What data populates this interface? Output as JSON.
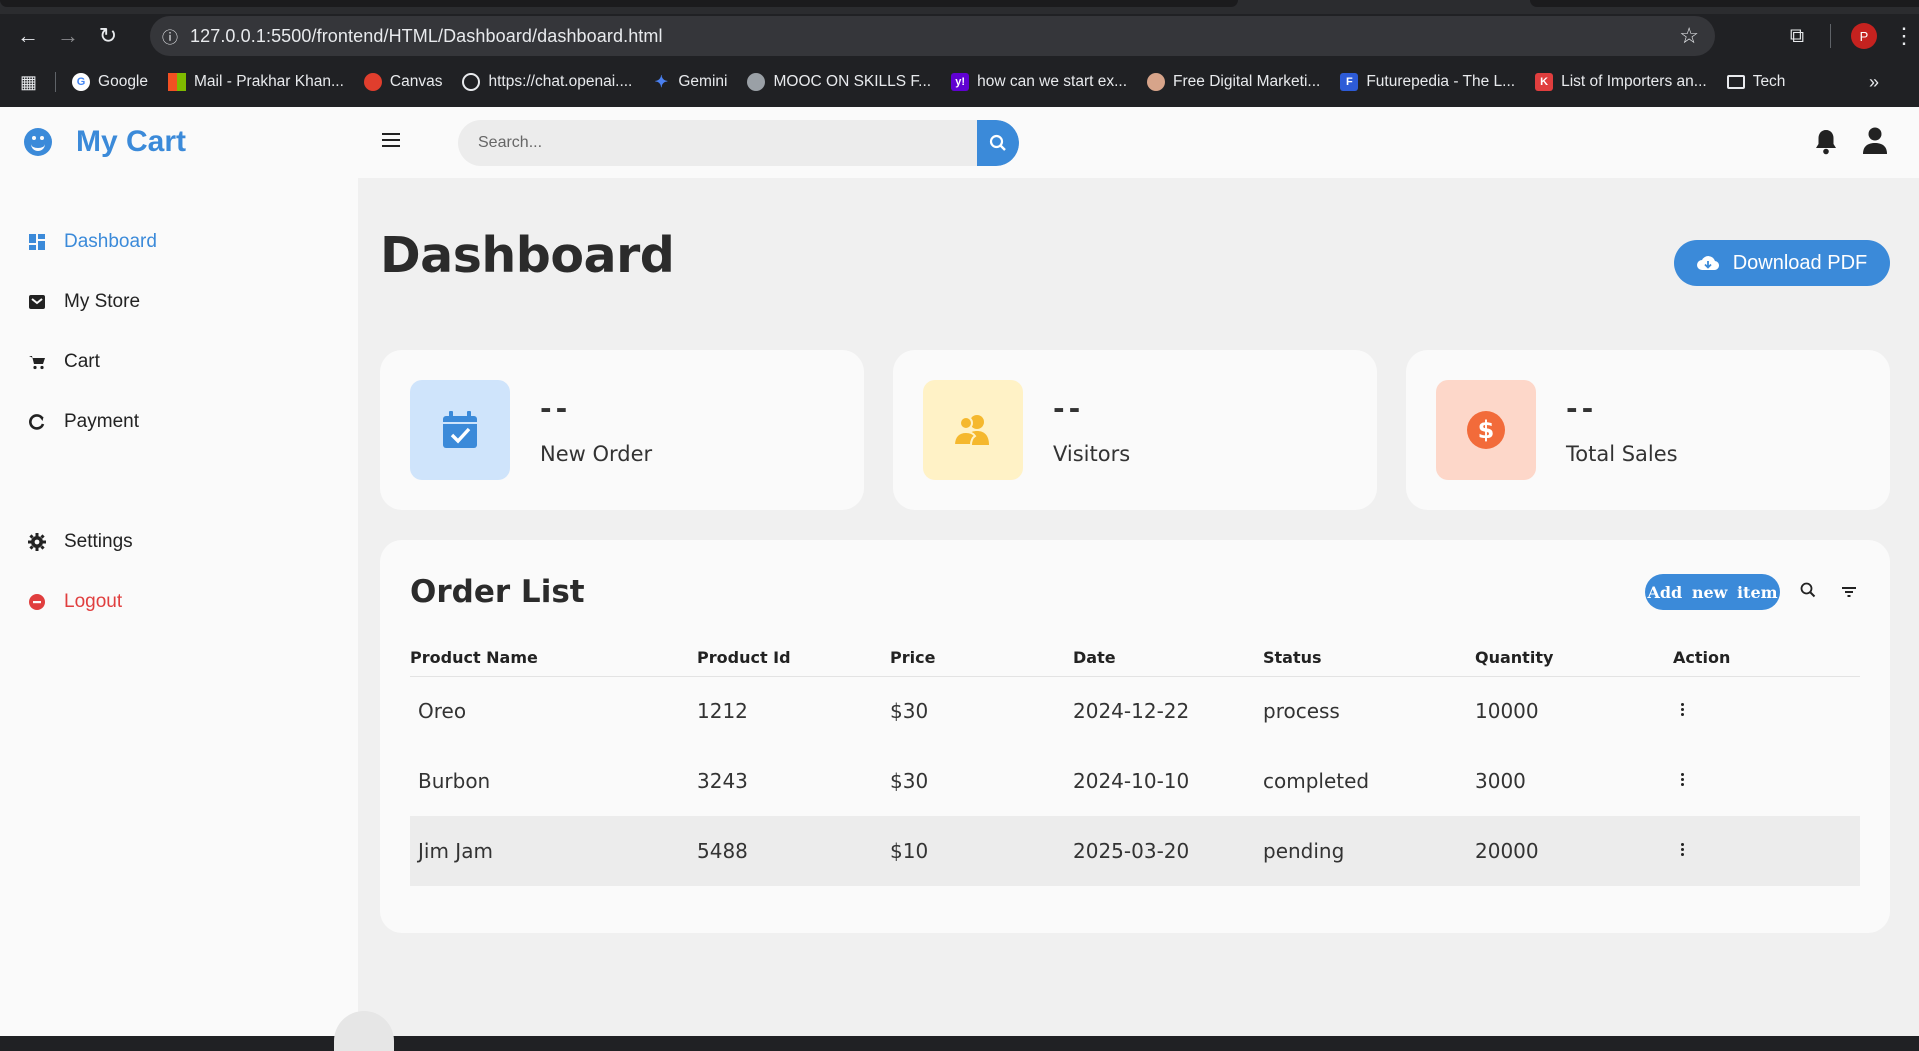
{
  "browser": {
    "url": "127.0.0.1:5500/frontend/HTML/Dashboard/dashboard.html",
    "profile_initial": "P",
    "bookmarks": [
      {
        "label": "Google",
        "color": "#ffffff"
      },
      {
        "label": "Mail - Prakhar Khan...",
        "color": "#f25022"
      },
      {
        "label": "Canvas",
        "color": "#e03e2d"
      },
      {
        "label": "https://chat.openai....",
        "color": "#202124"
      },
      {
        "label": "Gemini",
        "color": "#4a80f0"
      },
      {
        "label": "MOOC ON SKILLS F...",
        "color": "#9aa0a6"
      },
      {
        "label": "how can we start ex...",
        "color": "#6001d2"
      },
      {
        "label": "Free Digital Marketi...",
        "color": "#d7a48a"
      },
      {
        "label": "Futurepedia - The L...",
        "color": "#2d5bd7"
      },
      {
        "label": "List of Importers an...",
        "color": "#e03e3e"
      },
      {
        "label": "Tech",
        "color": "folder"
      }
    ]
  },
  "brand": {
    "name": "My Cart"
  },
  "sidebar": {
    "items": [
      {
        "label": "Dashboard",
        "icon": "dashboard-icon"
      },
      {
        "label": "My Store",
        "icon": "store-icon"
      },
      {
        "label": "Cart",
        "icon": "cart-icon"
      },
      {
        "label": "Payment",
        "icon": "payment-icon"
      },
      {
        "label": "Settings",
        "icon": "gear-icon"
      },
      {
        "label": "Logout",
        "icon": "logout-icon"
      }
    ]
  },
  "search": {
    "placeholder": "Search..."
  },
  "main": {
    "title": "Dashboard",
    "download_label": "Download PDF"
  },
  "stats": [
    {
      "value": "--",
      "label": "New Order",
      "bg": "#cfe4fb",
      "fg": "#3b8ad9"
    },
    {
      "value": "--",
      "label": "Visitors",
      "bg": "#fff2c6",
      "fg": "#f5b82e"
    },
    {
      "value": "--",
      "label": "Total Sales",
      "bg": "#fdd7c9",
      "fg": "#f26b3a"
    }
  ],
  "orders": {
    "title": "Order List",
    "add_label": "Add new item",
    "columns": [
      "Product Name",
      "Product Id",
      "Price",
      "Date",
      "Status",
      "Quantity",
      "Action"
    ],
    "rows": [
      [
        "Oreo",
        "1212",
        "$30",
        "2024-12-22",
        "process",
        "10000"
      ],
      [
        "Burbon",
        "3243",
        "$30",
        "2024-10-10",
        "completed",
        "3000"
      ],
      [
        "Jim Jam",
        "5488",
        "$10",
        "2025-03-20",
        "pending",
        "20000"
      ]
    ]
  },
  "colors": {
    "accent": "#3b8ad9",
    "logout": "#e03e3e"
  }
}
